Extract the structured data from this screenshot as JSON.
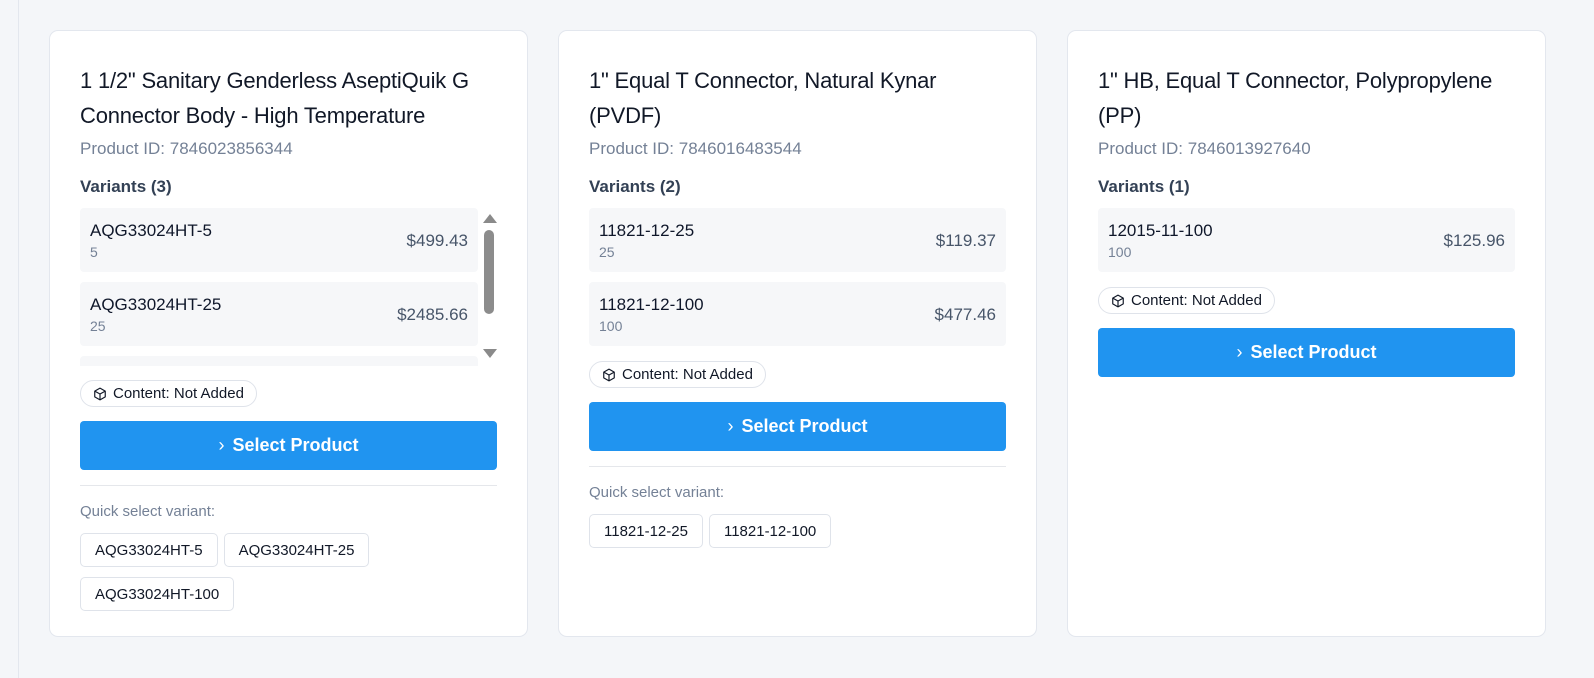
{
  "cards": [
    {
      "title": "1 1/2\" Sanitary Genderless AseptiQuik G Connector Body - High Temperature",
      "product_id": "Product ID: 7846023856344",
      "variants_label": "Variants (3)",
      "variants": [
        {
          "sku": "AQG33024HT-5",
          "qty": "5",
          "price": "$499.43"
        },
        {
          "sku": "AQG33024HT-25",
          "qty": "25",
          "price": "$2485.66"
        }
      ],
      "content_badge": "Content: Not Added",
      "select_label": "Select Product",
      "quick_label": "Quick select variant:",
      "quick_variants": [
        "AQG33024HT-5",
        "AQG33024HT-25",
        "AQG33024HT-100"
      ]
    },
    {
      "title": "1\" Equal T Connector, Natural Kynar (PVDF)",
      "product_id": "Product ID: 7846016483544",
      "variants_label": "Variants (2)",
      "variants": [
        {
          "sku": "11821-12-25",
          "qty": "25",
          "price": "$119.37"
        },
        {
          "sku": "11821-12-100",
          "qty": "100",
          "price": "$477.46"
        }
      ],
      "content_badge": "Content: Not Added",
      "select_label": "Select Product",
      "quick_label": "Quick select variant:",
      "quick_variants": [
        "11821-12-25",
        "11821-12-100"
      ]
    },
    {
      "title": "1\" HB, Equal T Connector, Polypropylene (PP)",
      "product_id": "Product ID: 7846013927640",
      "variants_label": "Variants (1)",
      "variants": [
        {
          "sku": "12015-11-100",
          "qty": "100",
          "price": "$125.96"
        }
      ],
      "content_badge": "Content: Not Added",
      "select_label": "Select Product"
    }
  ],
  "icons": {
    "badge": "cube-icon",
    "button": "chevron-right-icon"
  },
  "colors": {
    "accent": "#2094f0",
    "muted": "#748196",
    "background": "#f4f6f9"
  }
}
